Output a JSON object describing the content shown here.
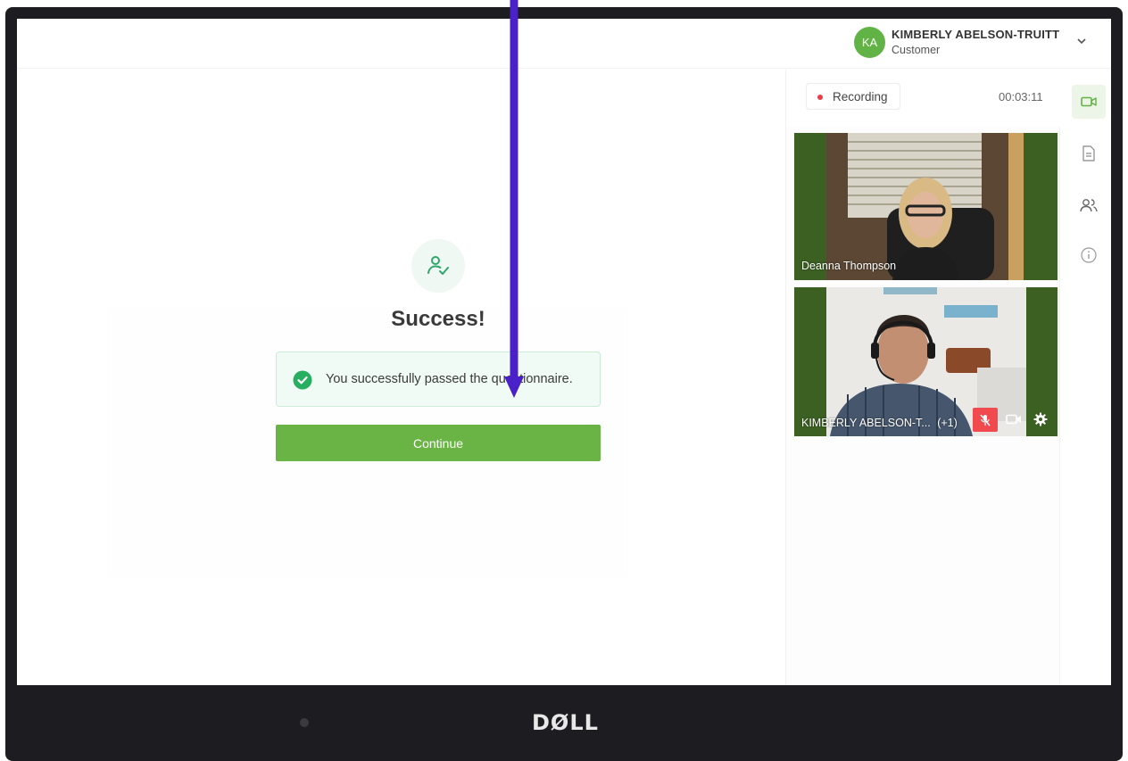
{
  "header": {
    "avatar_initials": "KA",
    "user_name": "KIMBERLY ABELSON-TRUITT",
    "user_role": "Customer"
  },
  "main": {
    "title": "Success!",
    "alert_text": "You successfully passed the questionnaire.",
    "continue_label": "Continue"
  },
  "panel": {
    "recording_label": "Recording",
    "timer": "00:03:11",
    "participants": [
      {
        "name": "Deanna Thompson"
      },
      {
        "name": "KIMBERLY ABELSON-T...",
        "extra": "(+1)"
      }
    ]
  },
  "device": {
    "brand": "DØLL"
  },
  "colors": {
    "accent_green": "#6ab446",
    "avatar_green": "#62b346",
    "recording_red": "#ec3b4c",
    "mic_off_red": "#f04a4f",
    "arrow_purple": "#4a20c9"
  }
}
